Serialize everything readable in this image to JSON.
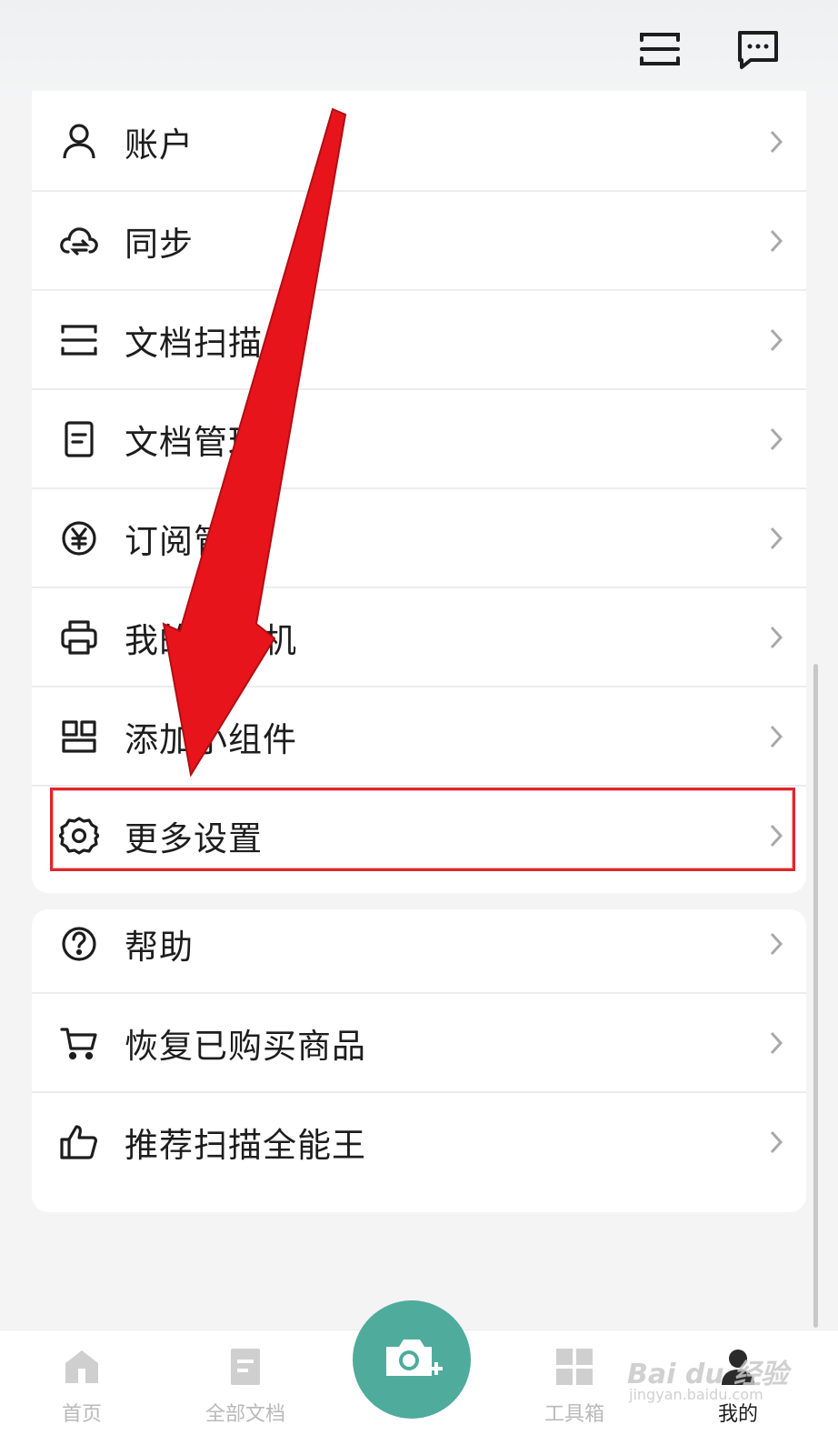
{
  "header": {
    "scan_icon": "scan-icon",
    "message_icon": "message-icon"
  },
  "menu_group_1": [
    {
      "label": "账户",
      "icon": "user-icon"
    },
    {
      "label": "同步",
      "icon": "cloud-sync-icon"
    },
    {
      "label": "文档扫描",
      "icon": "scan-icon"
    },
    {
      "label": "文档管理",
      "icon": "document-icon"
    },
    {
      "label": "订阅管理",
      "icon": "yen-circle-icon"
    },
    {
      "label": "我的打印机",
      "icon": "printer-icon"
    },
    {
      "label": "添加小组件",
      "icon": "widget-icon"
    },
    {
      "label": "更多设置",
      "icon": "gear-icon"
    }
  ],
  "menu_group_2": [
    {
      "label": "帮助",
      "icon": "help-icon"
    },
    {
      "label": "恢复已购买商品",
      "icon": "cart-icon"
    },
    {
      "label": "推荐扫描全能王",
      "icon": "thumbs-up-icon"
    }
  ],
  "tabbar": {
    "home": "首页",
    "all_docs": "全部文档",
    "toolbox": "工具箱",
    "mine": "我的"
  },
  "watermark": {
    "brand": "Bai du 经验",
    "url": "jingyan.baidu.com"
  },
  "colors": {
    "accent": "#4fab9c",
    "annotation": "#e0262c"
  }
}
